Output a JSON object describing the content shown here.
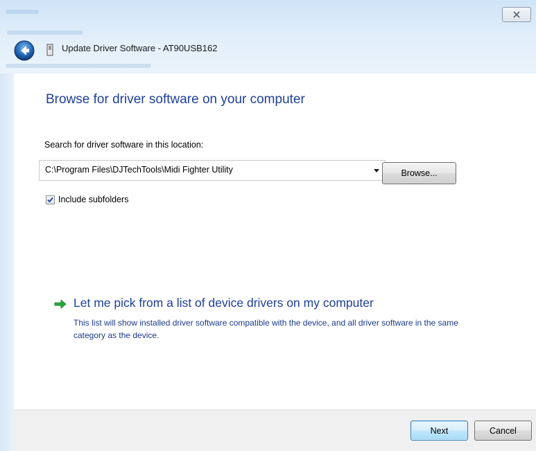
{
  "window": {
    "title": "Update Driver Software - AT90USB162",
    "close_icon": "close-icon",
    "back_icon": "back-arrow-icon",
    "device_icon": "usb-device-icon"
  },
  "content": {
    "heading": "Browse for driver software on your computer",
    "search_label": "Search for driver software in this location:",
    "path_value": "C:\\Program Files\\DJTechTools\\Midi Fighter Utility",
    "browse_label": "Browse...",
    "include_subfolders_label": "Include subfolders",
    "include_subfolders_checked": true,
    "pick_title": "Let me pick from a list of device drivers on my computer",
    "pick_description": "This list will show installed driver software compatible with the device, and all driver software in the same category as the device.",
    "pick_icon": "green-arrow-icon"
  },
  "footer": {
    "next_label": "Next",
    "cancel_label": "Cancel"
  },
  "colors": {
    "heading": "#1e3f9b",
    "link_description": "#1b3a8a",
    "frame": "#dcebf8",
    "footer": "#f0f0f0",
    "accent_arrow": "#22a93a"
  }
}
